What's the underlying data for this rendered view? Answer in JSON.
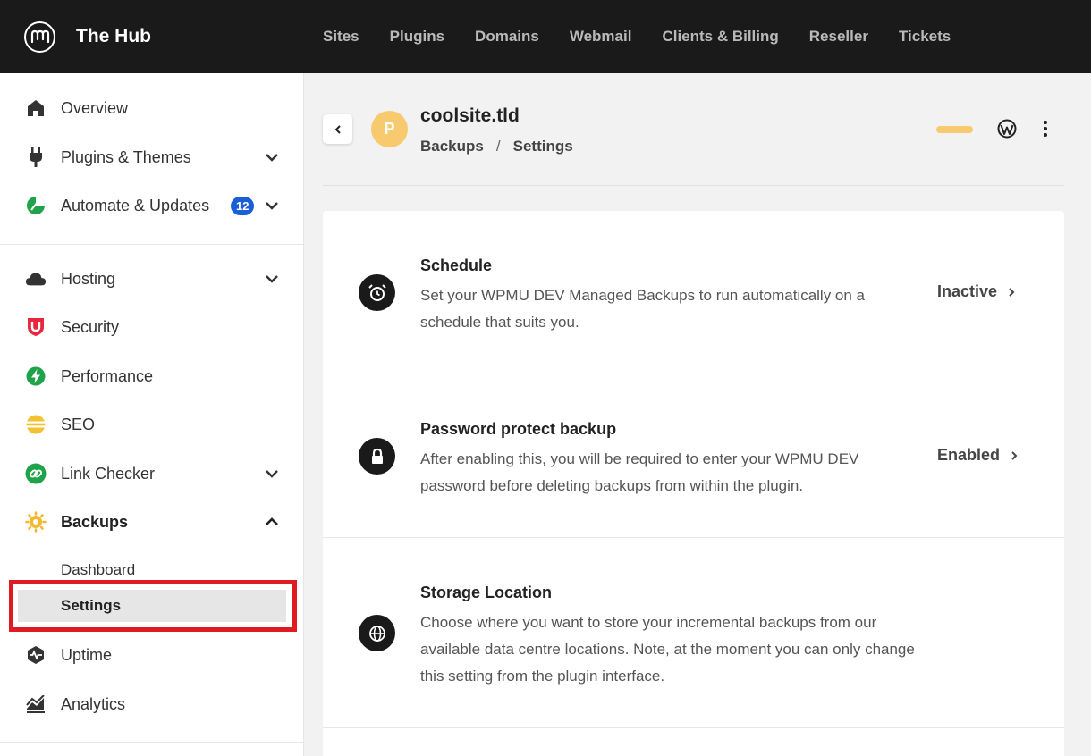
{
  "app": {
    "title": "The Hub"
  },
  "topnav": [
    "Sites",
    "Plugins",
    "Domains",
    "Webmail",
    "Clients & Billing",
    "Reseller",
    "Tickets"
  ],
  "sidebar": {
    "items": [
      {
        "label": "Overview"
      },
      {
        "label": "Plugins & Themes"
      },
      {
        "label": "Automate & Updates",
        "badge": "12"
      },
      {
        "label": "Hosting"
      },
      {
        "label": "Security"
      },
      {
        "label": "Performance"
      },
      {
        "label": "SEO"
      },
      {
        "label": "Link Checker"
      },
      {
        "label": "Backups"
      },
      {
        "label": "Uptime"
      },
      {
        "label": "Analytics"
      }
    ],
    "backups_sub": [
      {
        "label": "Dashboard"
      },
      {
        "label": "Settings"
      }
    ]
  },
  "header": {
    "avatar_letter": "P",
    "site_title": "coolsite.tld",
    "breadcrumb": {
      "parent": "Backups",
      "separator": "/",
      "current": "Settings"
    }
  },
  "settings": {
    "rows": [
      {
        "title": "Schedule",
        "desc": "Set your WPMU DEV Managed Backups to run automatically on a schedule that suits you.",
        "status": "Inactive"
      },
      {
        "title": "Password protect backup",
        "desc": "After enabling this, you will be required to enter your WPMU DEV password before deleting backups from within the plugin.",
        "status": "Enabled"
      },
      {
        "title": "Storage Location",
        "desc": "Choose where you want to store your incremental backups from our available data centre locations. Note, at the moment you can only change this setting from the plugin interface.",
        "status": ""
      }
    ]
  },
  "colors": {
    "topbar": "#1a1a1a",
    "badge": "#1a5fd6",
    "avatar": "#f7ca6f",
    "highlight": "#e01b24",
    "security": "#e8263d",
    "performance": "#1fa34a",
    "seo": "#f2c230",
    "backups": "#f5b82e"
  }
}
